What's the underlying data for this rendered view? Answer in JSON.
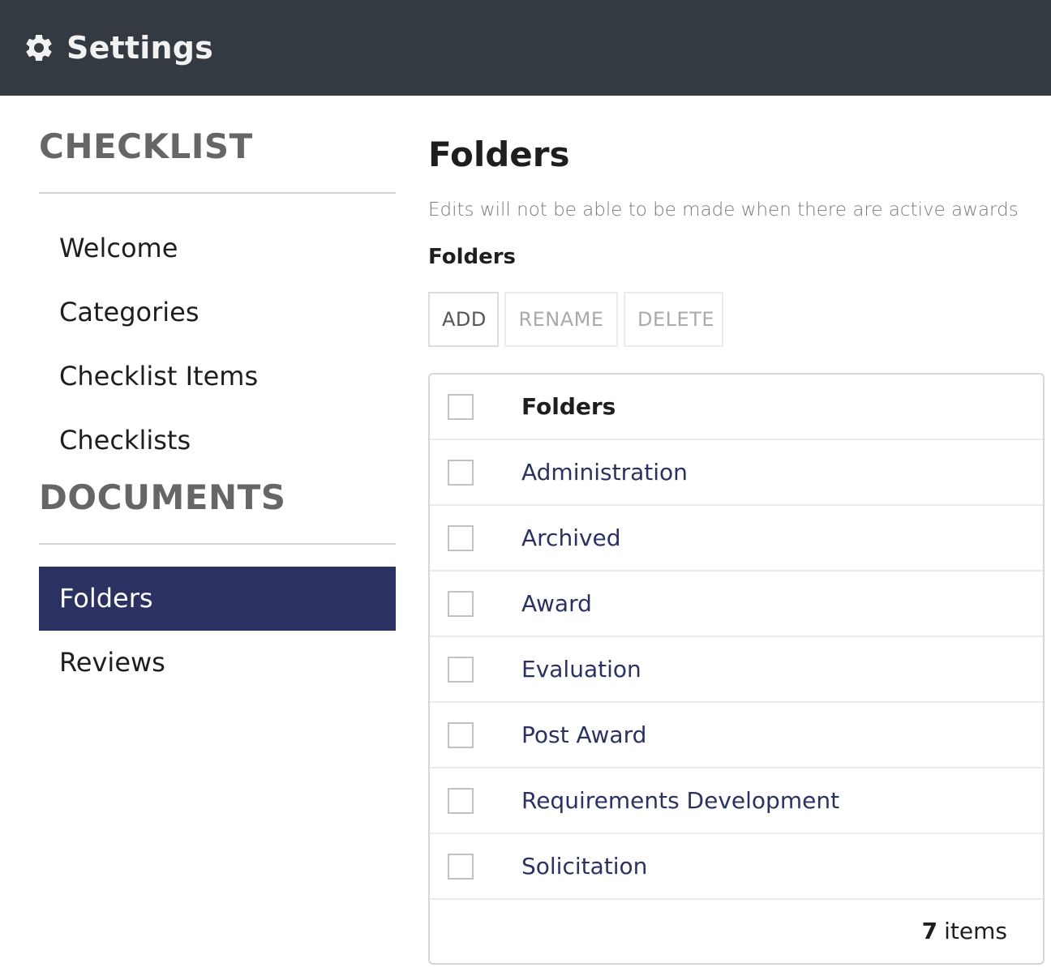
{
  "header": {
    "icon": "gear-icon",
    "title": "Settings",
    "background": "#343a41"
  },
  "sidebar": {
    "sections": [
      {
        "title": "CHECKLIST",
        "items": [
          {
            "label": "Welcome",
            "active": false
          },
          {
            "label": "Categories",
            "active": false
          },
          {
            "label": "Checklist Items",
            "active": false
          },
          {
            "label": "Checklists",
            "active": false
          }
        ]
      },
      {
        "title": "DOCUMENTS",
        "items": [
          {
            "label": "Folders",
            "active": true
          },
          {
            "label": "Reviews",
            "active": false
          }
        ]
      }
    ],
    "active_color": "#2b3262"
  },
  "main": {
    "title": "Folders",
    "notice": "Edits will not be able to be made when there are active awards",
    "subheading": "Folders",
    "toolbar": {
      "add_label": "ADD",
      "rename_label": "RENAME",
      "delete_label": "DELETE"
    },
    "grid": {
      "column_header": "Folders",
      "rows": [
        {
          "name": "Administration",
          "checked": false
        },
        {
          "name": "Archived",
          "checked": false
        },
        {
          "name": "Award",
          "checked": false
        },
        {
          "name": "Evaluation",
          "checked": false
        },
        {
          "name": "Post Award",
          "checked": false
        },
        {
          "name": "Requirements Development",
          "checked": false
        },
        {
          "name": "Solicitation",
          "checked": false
        }
      ],
      "footer": {
        "count": "7",
        "count_label": "items"
      },
      "link_color": "#2b3262"
    }
  }
}
